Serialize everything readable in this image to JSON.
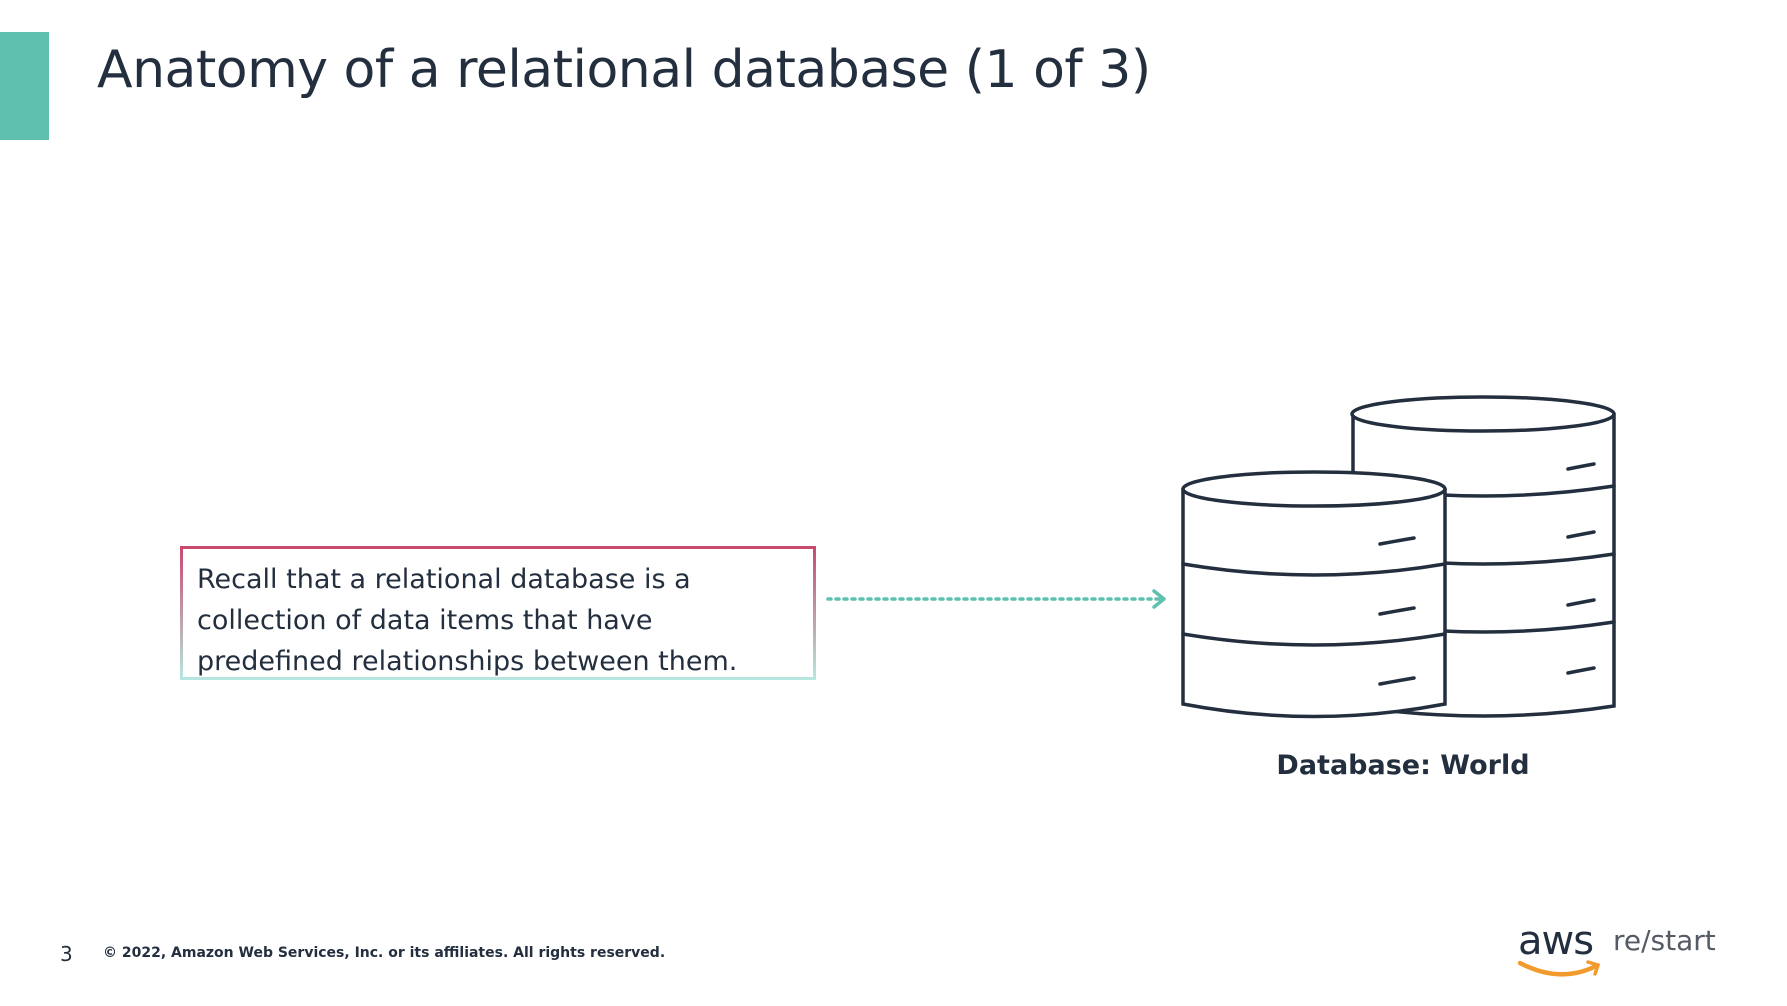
{
  "slide": {
    "title": "Anatomy of a relational database (1 of 3)",
    "callout_text": "Recall that a relational database is a collection of data items that have predefined relationships between them.",
    "database_label": "Database: World",
    "page_number": "3",
    "copyright": "© 2022, Amazon Web Services, Inc. or its affiliates. All rights reserved.",
    "logo": {
      "brand": "aws",
      "product": "re/start"
    }
  },
  "colors": {
    "accent": "#5fc0b0",
    "title": "#232f3e",
    "callout_top": "#c84a6e",
    "callout_bottom": "#b6e6df",
    "logo_smile": "#f29a2e"
  }
}
